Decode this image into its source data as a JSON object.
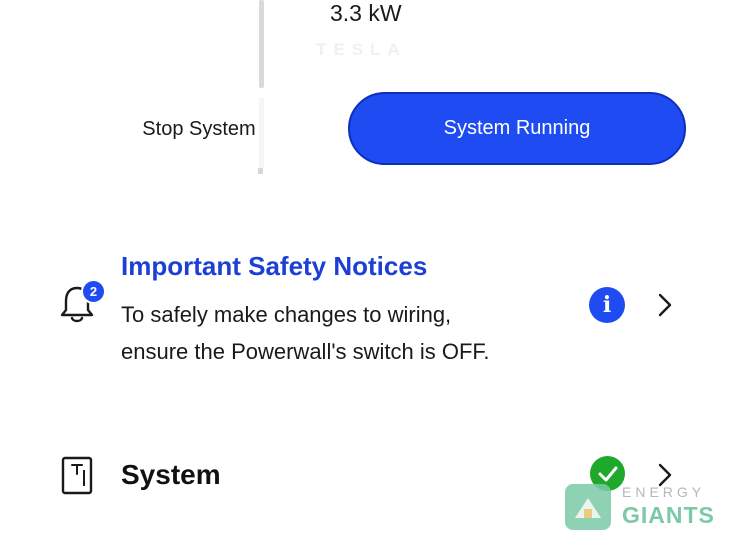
{
  "header": {
    "power_reading": "3.3 kW",
    "brand_watermark": "TESLA"
  },
  "controls": {
    "stop_label": "Stop System",
    "running_label": "System Running"
  },
  "notice": {
    "badge_count": "2",
    "title": "Important Safety Notices",
    "body_lines": [
      "To safely make changes to wiring,",
      "ensure the Powerwall's switch is OFF."
    ],
    "info_glyph": "i"
  },
  "system": {
    "label": "System",
    "status": "ok"
  },
  "watermark": {
    "line1": "ENERGY",
    "line2": "GIANTS"
  },
  "colors": {
    "accent": "#1f4bf2",
    "title_blue": "#1c3fd6",
    "success": "#1ea82c",
    "watermark_green": "#7cc9a6"
  },
  "icons": {
    "notice": "bell-icon",
    "info": "info-icon",
    "system": "device-icon",
    "status": "check-icon",
    "navigate": "chevron-right-icon"
  }
}
